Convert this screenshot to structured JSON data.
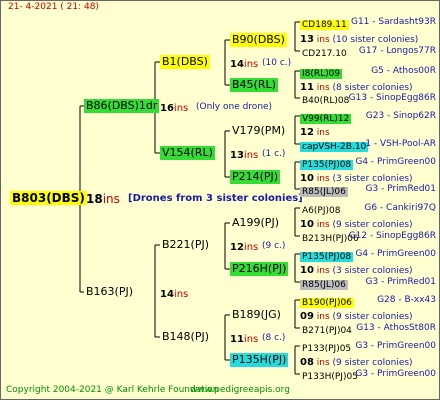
{
  "header": {
    "date": "21-  4-2021  ( 21:  48)"
  },
  "root": {
    "label": "B803(DBS)",
    "num": "18",
    "ins": "ins",
    "note": "[Drones from 3 sister colonies]",
    "color": "#ffff00"
  },
  "gen1": [
    {
      "label": "B86(DBS)1dr",
      "num": "16",
      "ins": "ins",
      "note": "(Only one drone)",
      "color": "#33dd33"
    },
    {
      "label": "B163(PJ)",
      "num": "14",
      "ins": "ins"
    }
  ],
  "gen2": [
    {
      "label": "B1(DBS)",
      "num": "14",
      "ins": "ins",
      "note": "(10 c.)",
      "color": "#ffff00"
    },
    {
      "label": "V154(RL)",
      "num": "13",
      "ins": "ins",
      "note": "(1 c.)",
      "color": "#33dd33"
    },
    {
      "label": "B221(PJ)",
      "num": "12",
      "ins": "ins",
      "note": "(9 c.)"
    },
    {
      "label": "B148(PJ)",
      "num": "11",
      "ins": "ins",
      "note": "(8 c.)"
    }
  ],
  "gen3": [
    {
      "label": "B90(DBS)",
      "color": "#ffff00"
    },
    {
      "label": "B45(RL)",
      "color": "#33dd33"
    },
    {
      "label": "V179(PM)"
    },
    {
      "label": "P214(PJ)",
      "color": "#33dd33"
    },
    {
      "label": "A199(PJ)"
    },
    {
      "label": "P216H(PJ)",
      "color": "#33dd33"
    },
    {
      "label": "B189(JG)"
    },
    {
      "label": "P135H(PJ)",
      "color": "#22dddd"
    }
  ],
  "gen4": [
    {
      "label": "CD189.11",
      "link": "G11 - Sardasht93R",
      "color": "#ffff00"
    },
    {
      "label": "13",
      "mid": "ins",
      "note": "(10 sister colonies)"
    },
    {
      "label": "CD217.10",
      "link": "G17 - Longos77R"
    },
    {
      "label": "I8(RL)09",
      "link": "G5 - Athos00R",
      "color": "#33dd33"
    },
    {
      "label": "11",
      "mid": "ins",
      "note": "(8 sister colonies)"
    },
    {
      "label": "B40(RL)08",
      "link": "G13 - SinopEgg86R"
    },
    {
      "label": "V99(RL)12",
      "link": "G23 - Sinop62R",
      "color": "#33dd33"
    },
    {
      "label": "12",
      "mid": "ins"
    },
    {
      "label": "capVSH-2B.10",
      "link": "1 - VSH-Pool-AR",
      "color": "#22dddd"
    },
    {
      "label": "P135(PJ)08",
      "link": "G4 - PrimGreen00",
      "color": "#22dddd"
    },
    {
      "label": "10",
      "mid": "ins",
      "note": "(3 sister colonies)"
    },
    {
      "label": "R85(JL)06",
      "link": "G3 - PrimRed01",
      "color": "#bbbbbb"
    },
    {
      "label": "A6(PJ)08",
      "link": "G6 - Cankiri97Q"
    },
    {
      "label": "10",
      "mid": "ins",
      "note": "(9 sister colonies)"
    },
    {
      "label": "B213H(PJ)06",
      "link": "G12 - SinopEgg86R"
    },
    {
      "label": "P135(PJ)08",
      "link": "G4 - PrimGreen00",
      "color": "#22dddd"
    },
    {
      "label": "10",
      "mid": "ins",
      "note": "(3 sister colonies)"
    },
    {
      "label": "R85(JL)06",
      "link": "G3 - PrimRed01",
      "color": "#bbbbbb"
    },
    {
      "label": "B190(PJ)06",
      "link": "G28 - B-xx43",
      "color": "#ffff00"
    },
    {
      "label": "09",
      "mid": "ins",
      "note": "(9 sister colonies)"
    },
    {
      "label": "B271(PJ)04",
      "link": "G13 - AthosSt80R"
    },
    {
      "label": "P133(PJ)05",
      "link": "G3 - PrimGreen00"
    },
    {
      "label": "08",
      "mid": "ins",
      "note": "(9 sister colonies)"
    },
    {
      "label": "P133H(PJ)05",
      "link": "G3 - PrimGreen00"
    }
  ],
  "footer": {
    "copyright": "Copyright 2004-2021 @ Karl Kehrle Foundation",
    "url": "www.pedigreeapis.org"
  }
}
